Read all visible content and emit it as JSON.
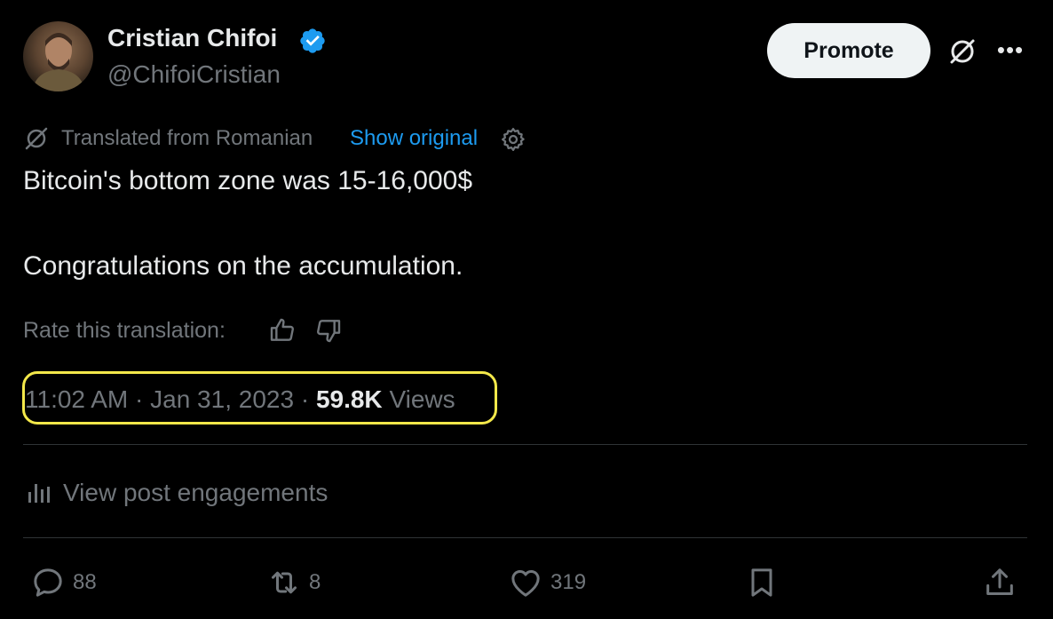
{
  "author": {
    "display_name": "Cristian Chifoi",
    "handle": "@ChifoiCristian",
    "verified": true
  },
  "header": {
    "promote_label": "Promote"
  },
  "translation": {
    "label": "Translated from Romanian",
    "show_original_label": "Show original"
  },
  "post": {
    "line1": "Bitcoin's bottom zone was 15-16,000$",
    "line2": "Congratulations on the accumulation."
  },
  "rate": {
    "label": "Rate this translation:"
  },
  "meta": {
    "time": "11:02 AM",
    "separator": "·",
    "date": "Jan 31, 2023",
    "views_count": "59.8K",
    "views_label": "Views",
    "highlight_color": "#f3e84a"
  },
  "engagements": {
    "label": "View post engagements"
  },
  "actions": {
    "replies": "88",
    "reposts": "8",
    "likes": "319"
  },
  "colors": {
    "background": "#000000",
    "text": "#e7e9ea",
    "muted": "#71767b",
    "link": "#1d9bf0",
    "verified": "#1d9bf0",
    "divider": "#2f3336"
  },
  "icons": {
    "verified": "verified-badge-icon",
    "grok": "grok-icon",
    "more": "more-icon",
    "translate": "translate-icon",
    "gear": "gear-icon",
    "thumb_up": "thumbs-up-icon",
    "thumb_down": "thumbs-down-icon",
    "engagements": "bar-chart-icon",
    "reply": "reply-icon",
    "repost": "repost-icon",
    "like": "heart-icon",
    "bookmark": "bookmark-icon",
    "share": "share-icon"
  }
}
